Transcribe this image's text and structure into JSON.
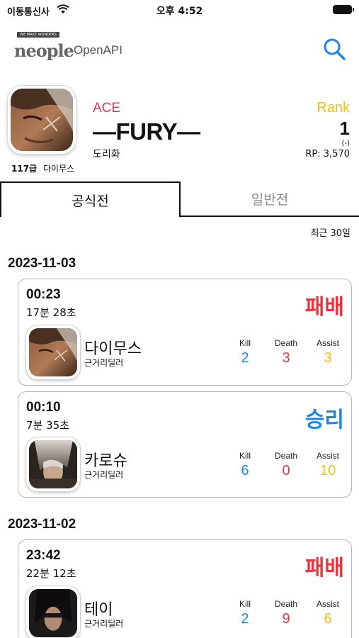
{
  "status_bar": {
    "carrier": "이동통신사",
    "time": "오후 4:52",
    "wifi_icon": "wifi-icon",
    "battery_icon": "battery-icon"
  },
  "header": {
    "logo_badge": "WE MAKE WONDERS",
    "logo_text": "neople",
    "logo_api": "OpenAPI",
    "search_icon": "search-icon"
  },
  "profile": {
    "level": "117급",
    "character": "다이무스",
    "guild": "ACE",
    "nickname": "—FURY—",
    "server": "도리화",
    "rank_label": "Rank",
    "rank": "1",
    "rank_change": "(-)",
    "rp": "RP: 3,570"
  },
  "tabs": [
    {
      "label": "공식전",
      "active": true
    },
    {
      "label": "일반전",
      "active": false
    }
  ],
  "filter": {
    "recent": "최근 30일"
  },
  "stat_labels": {
    "kill": "Kill",
    "death": "Death",
    "assist": "Assist"
  },
  "groups": [
    {
      "date": "2023-11-03",
      "matches": [
        {
          "time": "00:23",
          "duration": "17분 28초",
          "result": "패배",
          "character": "다이무스",
          "role": "근거리딜러",
          "kill": "2",
          "death": "3",
          "assist": "3"
        },
        {
          "time": "00:10",
          "duration": "7분 35초",
          "result": "승리",
          "character": "카로슈",
          "role": "근거리딜러",
          "kill": "6",
          "death": "0",
          "assist": "10"
        }
      ]
    },
    {
      "date": "2023-11-02",
      "matches": [
        {
          "time": "23:42",
          "duration": "22분 12초",
          "result": "패배",
          "character": "테이",
          "role": "근거리딜러",
          "kill": "2",
          "death": "9",
          "assist": "6"
        }
      ]
    }
  ],
  "colors": {
    "lose": "#e8353d",
    "win": "#1a86e8",
    "kill": "#1a86e8",
    "death": "#e8353d",
    "assist": "#f3c10b",
    "guild": "#e8315b",
    "rank": "#f3c10b"
  }
}
